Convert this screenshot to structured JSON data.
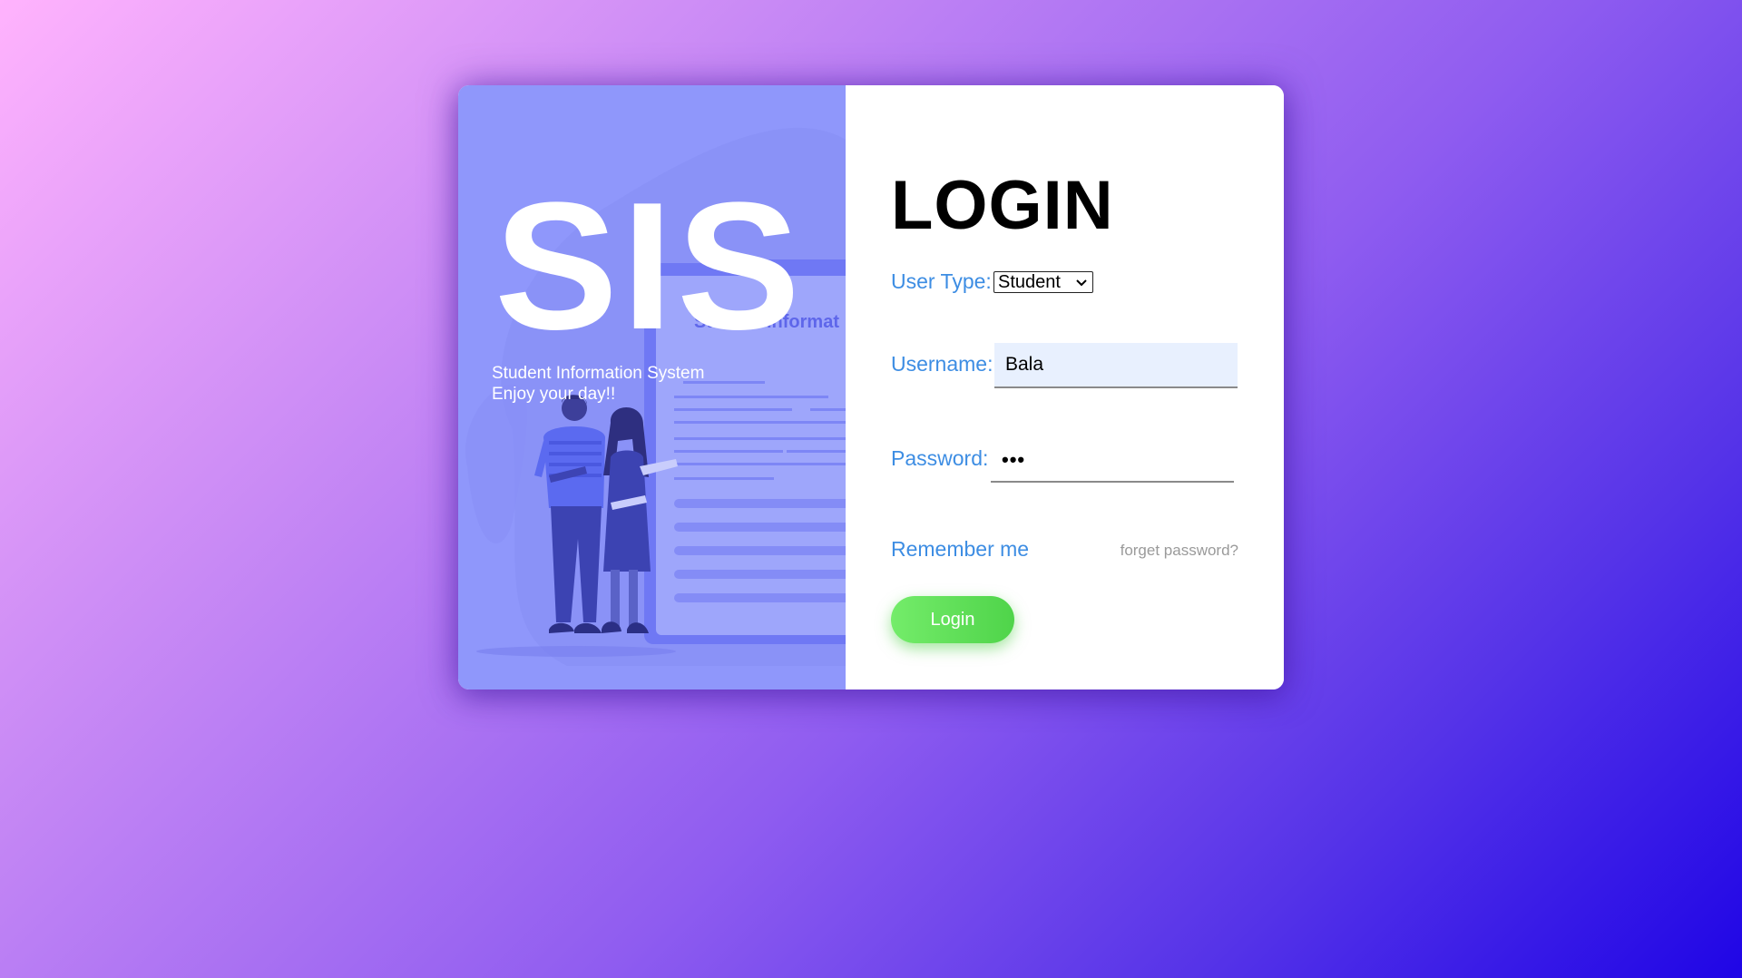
{
  "left_panel": {
    "brand": "SIS",
    "tagline_line1": "Student Information System",
    "tagline_line2": "Enjoy your day!!",
    "board_caption": "Student Informat"
  },
  "login_form": {
    "title": "LOGIN",
    "user_type_label": "User Type:",
    "user_type_selected": "Student",
    "username_label": "Username:",
    "username_value": "Bala",
    "password_label": "Password:",
    "password_masked": "•••",
    "remember_label": "Remember me",
    "forget_label": "forget password?",
    "login_button_label": "Login"
  },
  "colors": {
    "left_panel_bg": "#8f97fb",
    "label_blue": "#3d8de3",
    "button_green": "#5bdc55",
    "muted_gray": "#9a9a9a"
  },
  "icons": {
    "select_arrow": "chevron-down-icon"
  }
}
